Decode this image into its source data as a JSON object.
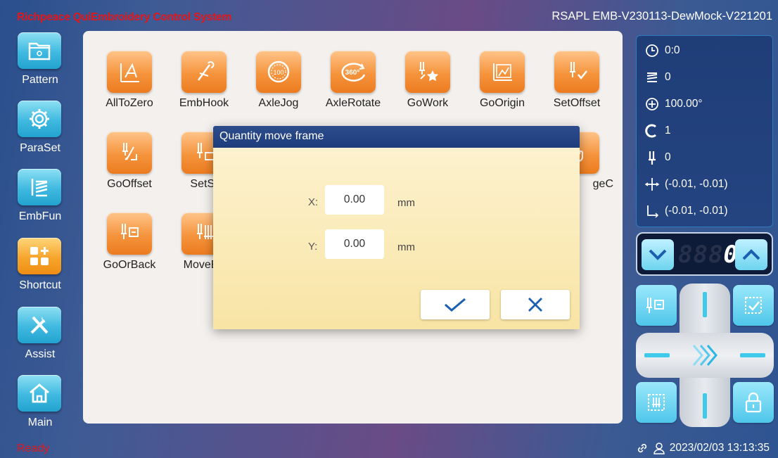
{
  "header": {
    "app_title": "Richpeace QuiEmbroidery Control System",
    "version": "RSAPL EMB-V230113-DewMock-V221201",
    "title_color": "#e3161b"
  },
  "sidebar": {
    "items": [
      {
        "label": "Pattern",
        "icon": "folder-icon",
        "active": false
      },
      {
        "label": "ParaSet",
        "icon": "gear-icon",
        "active": false
      },
      {
        "label": "EmbFun",
        "icon": "stitch-icon",
        "active": false
      },
      {
        "label": "Shortcut",
        "icon": "grid-plus-icon",
        "active": true
      },
      {
        "label": "Assist",
        "icon": "tools-icon",
        "active": false
      },
      {
        "label": "Main",
        "icon": "home-icon",
        "active": false
      }
    ]
  },
  "functions": {
    "row1": [
      {
        "label": "AllToZero",
        "icon": "all-to-zero-icon"
      },
      {
        "label": "EmbHook",
        "icon": "emb-hook-icon"
      },
      {
        "label": "AxleJog",
        "icon": "axle-jog-icon"
      },
      {
        "label": "AxleRotate",
        "icon": "axle-rotate-icon"
      },
      {
        "label": "GoWork",
        "icon": "go-work-icon"
      },
      {
        "label": "GoOrigin",
        "icon": "go-origin-icon"
      },
      {
        "label": "SetOffset",
        "icon": "set-offset-icon"
      }
    ],
    "row2": [
      {
        "label": "GoOffset",
        "icon": "go-offset-icon"
      },
      {
        "label": "SetSt",
        "icon": "set-start-icon"
      },
      {
        "label": "geC",
        "icon": "change-icon"
      }
    ],
    "row3": [
      {
        "label": "GoOrBack",
        "icon": "go-or-back-icon"
      },
      {
        "label": "MoveBo",
        "icon": "move-border-icon"
      }
    ],
    "axle_rotate_badge": "360°",
    "axle_jog_badge": "100"
  },
  "status": {
    "time": "0:0",
    "stitches": "0",
    "angle": "100.00°",
    "color": "1",
    "needle": "0",
    "position": "(-0.01, -0.01)",
    "origin": "(-0.01, -0.01)"
  },
  "counter": {
    "value": "0",
    "placeholder_digits": "888"
  },
  "dialog": {
    "title": "Quantity move frame",
    "x_label": "X:",
    "x_value": "0.00",
    "y_label": "Y:",
    "y_value": "0.00",
    "unit": "mm",
    "confirm_icon": "check-icon",
    "cancel_icon": "close-icon"
  },
  "footer": {
    "status_text": "Ready",
    "datetime": "2023/02/03 13:13:35"
  }
}
